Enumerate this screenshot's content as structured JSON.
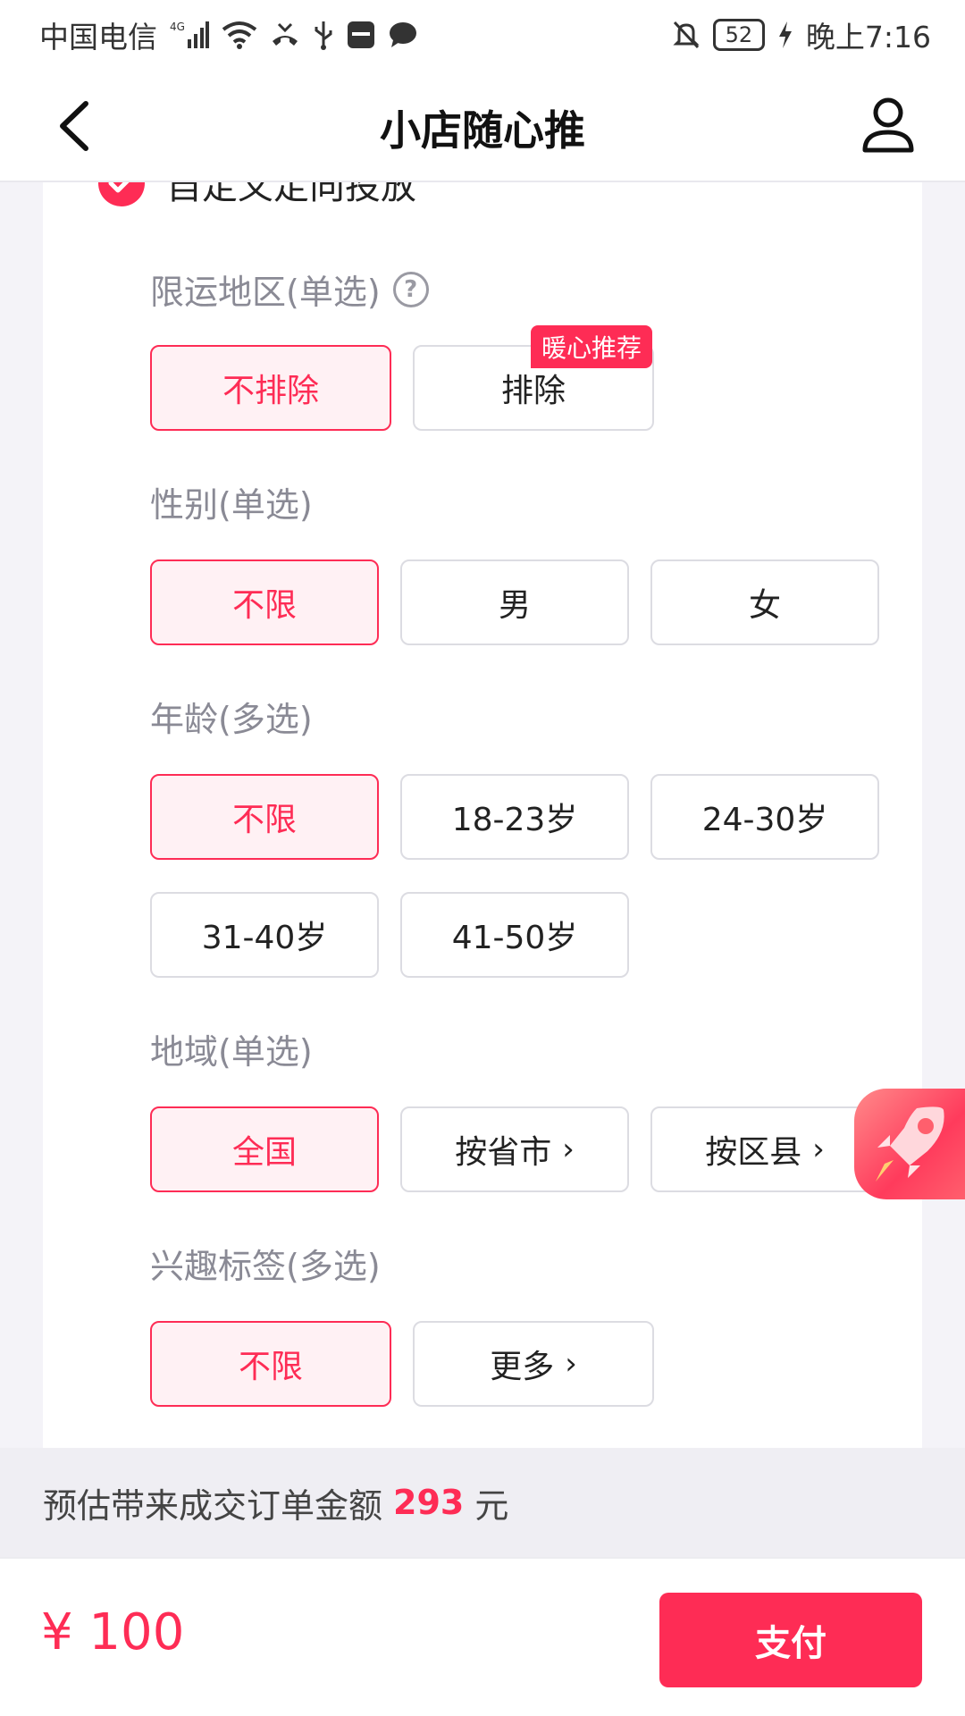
{
  "status_bar": {
    "carrier": "中国电信",
    "network": "4G",
    "battery": "52",
    "time": "晚上7:16"
  },
  "header": {
    "title": "小店随心推"
  },
  "custom_targeting": {
    "label": "自定义定向投放"
  },
  "sections": {
    "restricted_region": {
      "label": "限运地区(单选)",
      "options": [
        "不排除",
        "排除"
      ],
      "badge": "暖心推荐"
    },
    "gender": {
      "label": "性别(单选)",
      "options": [
        "不限",
        "男",
        "女"
      ]
    },
    "age": {
      "label": "年龄(多选)",
      "options": [
        "不限",
        "18-23岁",
        "24-30岁",
        "31-40岁",
        "41-50岁"
      ]
    },
    "region": {
      "label": "地域(单选)",
      "options": [
        "全国",
        "按省市",
        "按区县"
      ]
    },
    "interests": {
      "label": "兴趣标签(多选)",
      "options": [
        "不限",
        "更多"
      ]
    }
  },
  "estimate": {
    "prefix": "预估带来成交订单金额",
    "amount": "293",
    "unit": "元"
  },
  "footer": {
    "price": "¥ 100",
    "pay_label": "支付"
  },
  "colors": {
    "accent": "#fe2c55",
    "selected_bg": "#fff1f4"
  }
}
